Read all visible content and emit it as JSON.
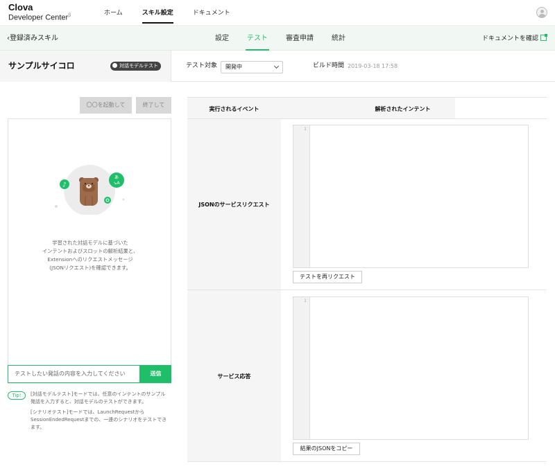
{
  "header": {
    "logo_main": "Clova",
    "logo_sub": "Developer Center",
    "logo_sup": "β",
    "nav": [
      {
        "label": "ホーム",
        "active": false
      },
      {
        "label": "スキル設定",
        "active": true
      },
      {
        "label": "ドキュメント",
        "active": false
      }
    ]
  },
  "subnav": {
    "back_label": "登録済みスキル",
    "tabs": [
      {
        "label": "設定",
        "active": false
      },
      {
        "label": "テスト",
        "active": true
      },
      {
        "label": "審査申請",
        "active": false
      },
      {
        "label": "統計",
        "active": false
      }
    ],
    "doc_link": "ドキュメントを確認"
  },
  "titlebar": {
    "skill_name": "サンプルサイコロ",
    "mode_toggle_label": "対話モデルテスト",
    "target_label": "テスト対象",
    "target_value": "開発中",
    "build_label": "ビルド時間",
    "build_time": "2019-03-18 17:58"
  },
  "left_panel": {
    "launch_button": "〇〇を起動して",
    "end_button": "終了して",
    "description_lines": [
      "学習された対話モデルに基づいた",
      "インテントおよびスロットの解析結果と、",
      "Extensionへのリクエストメッセージ",
      "(JSONリクエスト)を確認できます。"
    ],
    "illustration_badge": "あ\n↘A",
    "input_placeholder": "テストしたい発話の内容を入力してください",
    "send_button": "送信",
    "tip_badge": "Tip!",
    "tip_lines_1": [
      "[対話モデルテスト]モードでは、任意のインテントのサンプル",
      "発話を入力すると、対話モデルのテストができます。"
    ],
    "tip_lines_2": [
      "[シナリオテスト]モードでは、LaunchRequestから",
      "SessionEndedRequestまでの、一連のシナリオをテストでき",
      "ます。"
    ]
  },
  "right_panel": {
    "col_event": "実行されるイベント",
    "col_intent": "解析されたインテント",
    "row1_label": "JSONのサービスリクエスト",
    "row1_line_number": "1",
    "row1_button": "テストを再リクエスト",
    "row2_label": "サービス応答",
    "row2_line_number": "1",
    "row2_button": "結果のJSONをコピー"
  },
  "colors": {
    "accent": "#1fbf6a",
    "subnav_bg": "#f1f8f4",
    "panel_gray": "#f5f5f5"
  }
}
